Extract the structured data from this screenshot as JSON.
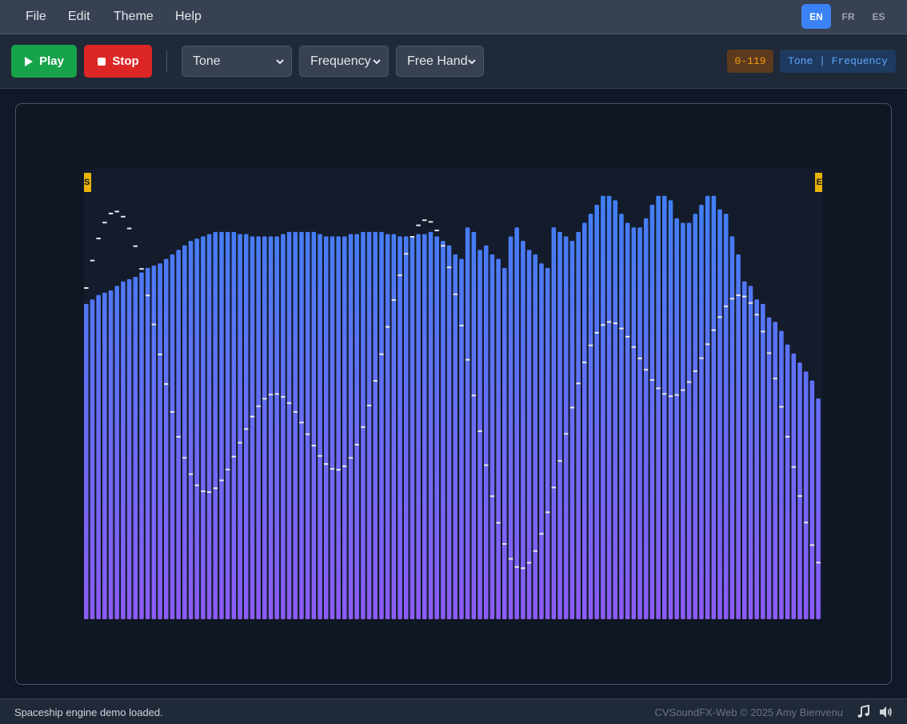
{
  "menu": {
    "file": "File",
    "edit": "Edit",
    "theme": "Theme",
    "help": "Help"
  },
  "languages": {
    "en": "EN",
    "fr": "FR",
    "es": "ES",
    "active": "EN"
  },
  "toolbar": {
    "play_label": "Play",
    "stop_label": "Stop",
    "wave_select": "Tone",
    "param_select": "Frequency",
    "draw_select": "Free Hand",
    "range_badge": "0-119",
    "mode_badge": "Tone | Frequency"
  },
  "markers": {
    "start": "S",
    "end": "E"
  },
  "chart_data": {
    "type": "bar",
    "x": [
      0,
      119
    ],
    "ylim": [
      0,
      100
    ],
    "grid": false,
    "values": [
      70,
      71,
      72,
      72.5,
      73,
      74,
      75,
      75.5,
      76,
      77,
      78,
      78.5,
      79,
      80,
      81,
      82,
      83,
      84,
      84.5,
      85,
      85.5,
      86,
      86,
      86,
      86,
      85.5,
      85.5,
      85,
      85,
      85,
      85,
      85,
      85.5,
      86,
      86,
      86,
      86,
      86,
      85.5,
      85,
      85,
      85,
      85,
      85.5,
      85.5,
      86,
      86,
      86,
      86,
      85.5,
      85.5,
      85,
      85,
      85,
      85.5,
      85.5,
      86,
      85,
      84,
      83,
      81,
      80,
      87,
      86,
      82,
      83,
      81,
      80,
      78,
      85,
      87,
      84,
      82,
      81,
      79,
      78,
      87,
      86,
      85,
      84,
      86,
      88,
      90,
      92,
      94,
      94,
      93,
      90,
      88,
      87,
      87,
      89,
      92,
      94,
      94,
      93,
      89,
      88,
      88,
      90,
      92,
      94,
      94,
      91,
      90,
      85,
      81,
      75,
      74,
      71,
      70,
      67,
      66,
      64,
      61,
      59,
      57,
      55,
      53,
      49
    ]
  },
  "status": {
    "message": "Spaceship engine demo loaded.",
    "credit": "CVSoundFX-Web © 2025 Amy Bienvenu"
  },
  "colors": {
    "bar_top": "#3b82f6",
    "bar_bottom": "#8b5cf6",
    "accent": "#3b82f6",
    "marker": "#eab308"
  },
  "icons": {
    "play": "play-icon",
    "stop": "stop-icon",
    "music": "music-note-icon",
    "volume": "volume-icon"
  }
}
